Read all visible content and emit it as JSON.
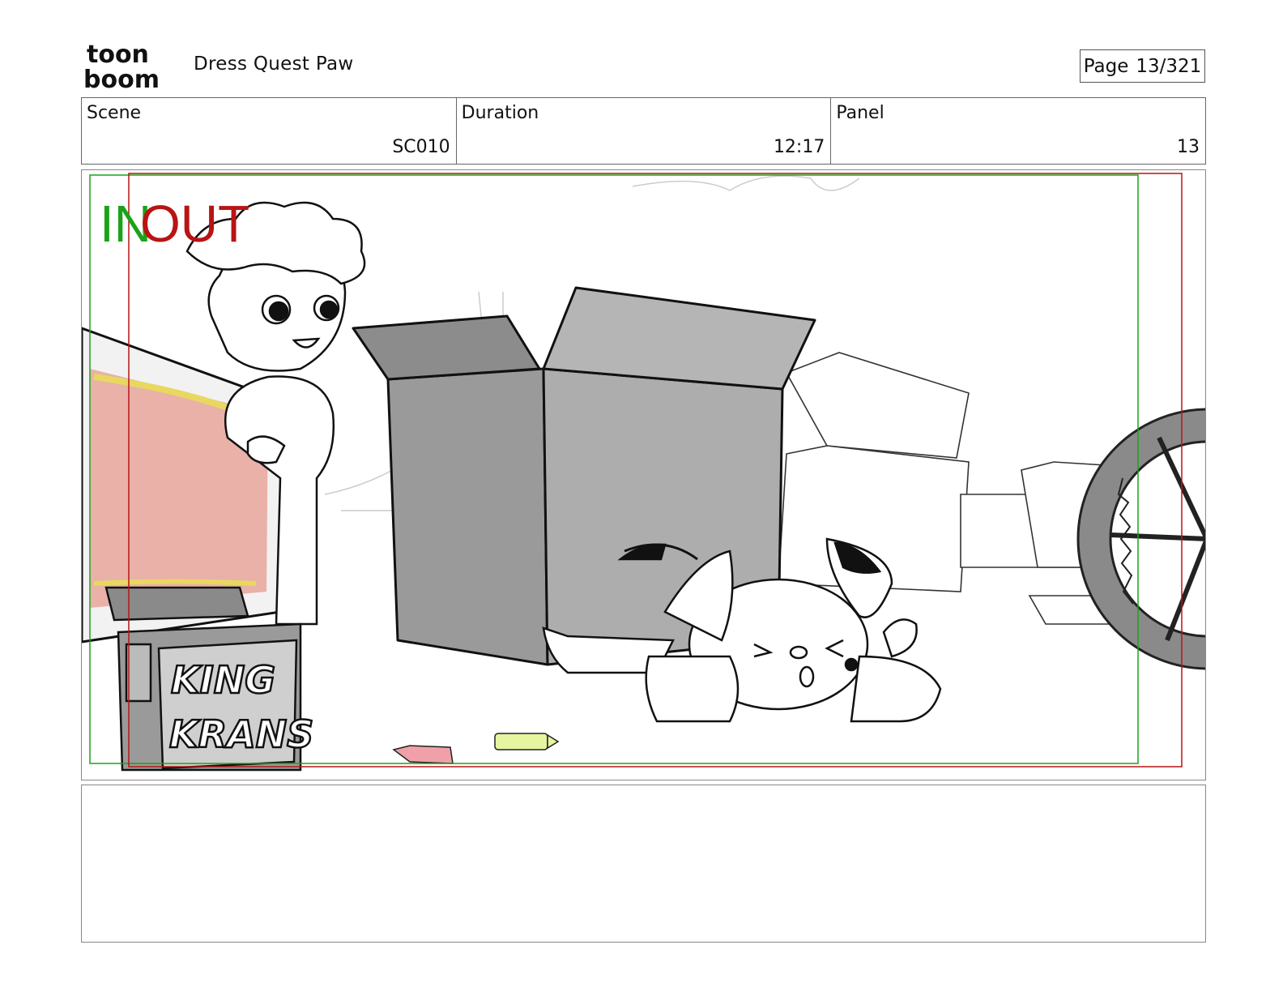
{
  "header": {
    "logo_line1": "toon",
    "logo_line2": "boom",
    "project_title": "Dress Quest Paw",
    "page_label": "Page",
    "page_value": "13/321"
  },
  "info": {
    "scene_label": "Scene",
    "scene_value": "SC010",
    "duration_label": "Duration",
    "duration_value": "12:17",
    "panel_label": "Panel",
    "panel_value": "13"
  },
  "panel": {
    "marker_in": "IN",
    "marker_out": "OUT",
    "box_text_line1": "KING",
    "box_text_line2": "KRANS",
    "colors": {
      "in_marker": "#1aa31a",
      "out_marker": "#b81414",
      "box_gray": "#9a9a9a",
      "tv_screen": "#e8aaa0",
      "crayon_pink": "#f0a0a8",
      "crayon_green": "#e6f5a0"
    }
  },
  "notes": {
    "text": ""
  }
}
